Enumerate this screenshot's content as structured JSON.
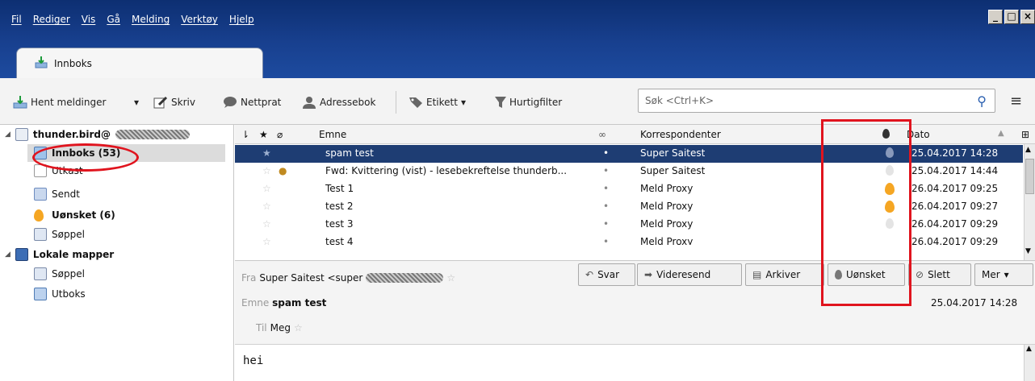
{
  "menu": [
    "Fil",
    "Rediger",
    "Vis",
    "Gå",
    "Melding",
    "Verktøy",
    "Hjelp"
  ],
  "tab": {
    "label": "Innboks"
  },
  "toolbar": {
    "get_messages": "Hent meldinger",
    "write": "Skriv",
    "chat": "Nettprat",
    "address_book": "Adressebok",
    "tag": "Etikett",
    "quick_filter": "Hurtigfilter",
    "search_placeholder": "Søk <Ctrl+K>"
  },
  "folders": [
    {
      "label": "thunder.bird@",
      "bold": true
    },
    {
      "label": "Innboks (53)",
      "bold": true
    },
    {
      "label": "Utkast",
      "bold": false
    },
    {
      "label": "Sendt",
      "bold": false
    },
    {
      "label": "Uønsket (6)",
      "bold": true
    },
    {
      "label": "Søppel",
      "bold": false
    },
    {
      "label": "Lokale mapper",
      "bold": true
    },
    {
      "label": "Søppel",
      "bold": false
    },
    {
      "label": "Utboks",
      "bold": false
    }
  ],
  "columns": {
    "subject": "Emne",
    "correspondents": "Korrespondenter",
    "date": "Dato"
  },
  "messages": [
    {
      "subject": "spam test",
      "correspondent": "Super Saitest",
      "date": "25.04.2017 14:28"
    },
    {
      "subject": "Fwd: Kvittering (vist) - lesebekreftelse thunderb...",
      "correspondent": "Super Saitest",
      "date": "25.04.2017 14:44"
    },
    {
      "subject": "Test 1",
      "correspondent": "Meld Proxy",
      "date": "26.04.2017 09:25"
    },
    {
      "subject": "test 2",
      "correspondent": "Meld Proxy",
      "date": "26.04.2017 09:27"
    },
    {
      "subject": "test 3",
      "correspondent": "Meld Proxy",
      "date": "26.04.2017 09:29"
    },
    {
      "subject": "test 4",
      "correspondent": "Meld Proxy",
      "date": "26.04.2017 09:29"
    }
  ],
  "header": {
    "from_label": "Fra",
    "from_value": "Super Saitest <super",
    "subject_label": "Emne",
    "subject_value": "spam test",
    "to_label": "Til",
    "to_value": "Meg",
    "date": "25.04.2017 14:28"
  },
  "actions": {
    "reply": "Svar",
    "forward": "Videresend",
    "archive": "Arkiver",
    "junk": "Uønsket",
    "delete": "Slett",
    "more": "Mer"
  },
  "body": {
    "text": "hei"
  },
  "colors": {
    "title": "#18408f",
    "selected_row": "#1e3d73",
    "annotation": "#e0141e",
    "junk_flame": "#f5a623"
  }
}
